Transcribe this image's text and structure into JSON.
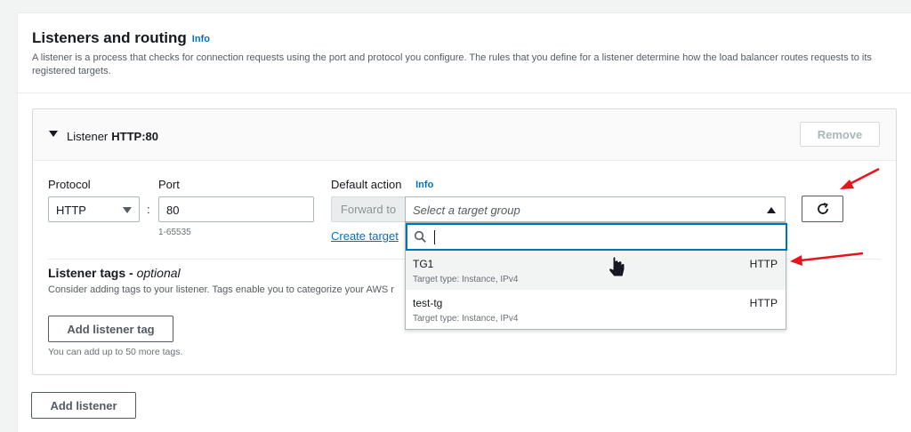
{
  "section": {
    "title": "Listeners and routing",
    "info_label": "Info",
    "description": "A listener is a process that checks for connection requests using the port and protocol you configure. The rules that you define for a listener determine how the load balancer routes requests to its registered targets."
  },
  "listener": {
    "label": "Listener",
    "name": "HTTP:80",
    "remove_label": "Remove",
    "protocol_label": "Protocol",
    "protocol_value": "HTTP",
    "colon": ":",
    "port_label": "Port",
    "port_value": "80",
    "port_hint": "1-65535",
    "default_action_label": "Default action",
    "default_action_info": "Info",
    "forward_label": "Forward to",
    "target_placeholder": "Select a target group",
    "create_link": "Create target"
  },
  "dropdown": {
    "options": [
      {
        "name": "TG1",
        "protocol": "HTTP",
        "detail": "Target type: Instance, IPv4"
      },
      {
        "name": "test-tg",
        "protocol": "HTTP",
        "detail": "Target type: Instance, IPv4"
      }
    ]
  },
  "tags": {
    "title": "Listener tags - ",
    "title_optional": "optional",
    "description": "Consider adding tags to your listener. Tags enable you to categorize your AWS r",
    "add_tag_label": "Add listener tag",
    "limit_hint": "You can add up to 50 more tags."
  },
  "add_listener_label": "Add listener",
  "colors": {
    "link": "#0073bb",
    "annotation_arrow": "#e8141b"
  }
}
